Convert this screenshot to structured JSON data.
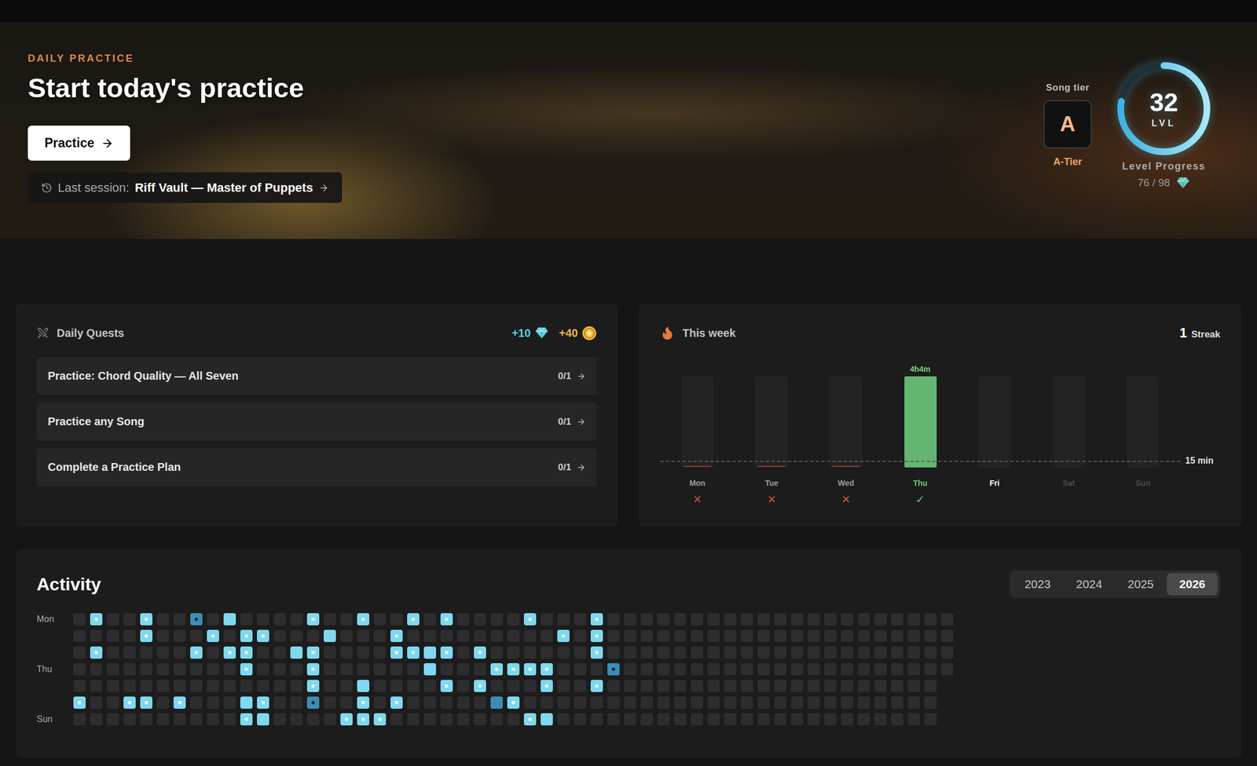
{
  "hero": {
    "eyebrow": "DAILY PRACTICE",
    "title": "Start today's practice",
    "button": "Practice",
    "last_session": {
      "label": "Last session:",
      "value": "Riff Vault — Master of Puppets"
    }
  },
  "song_tier": {
    "label": "Song tier",
    "grade": "A",
    "name": "A-Tier"
  },
  "level": {
    "value": "32",
    "unit": "LVL",
    "caption": "Level Progress",
    "reading": "76 / 98",
    "level": 0.776
  },
  "quests": {
    "title": "Daily Quests",
    "rewards": [
      {
        "amount": "+10",
        "kind": "gem",
        "color": "#5fd0e4"
      },
      {
        "amount": "+40",
        "kind": "coin",
        "color": "#f0b93a"
      }
    ],
    "items": [
      {
        "label": "Practice: Chord Quality — All Seven",
        "progress": "0/1"
      },
      {
        "label": "Practice any Song",
        "progress": "0/1"
      },
      {
        "label": "Complete a Practice Plan",
        "progress": "0/1"
      }
    ]
  },
  "week": {
    "title": "This week",
    "streak": {
      "count": "1",
      "label": "Streak"
    },
    "goal": {
      "minutes": 15,
      "label": "15 min"
    },
    "days": [
      {
        "label": "Mon",
        "minutes": 0,
        "mark": "✕",
        "status": "missed"
      },
      {
        "label": "Tue",
        "minutes": 0,
        "mark": "✕",
        "status": "missed"
      },
      {
        "label": "Wed",
        "minutes": 0,
        "mark": "✕",
        "status": "missed"
      },
      {
        "label": "Thu",
        "minutes": 244,
        "reading": "4h4m",
        "mark": "✓",
        "status": "done"
      },
      {
        "label": "Fri",
        "minutes": 0,
        "status": "today"
      },
      {
        "label": "Sat",
        "minutes": 0,
        "status": "upcoming"
      },
      {
        "label": "Sun",
        "minutes": 0,
        "status": "upcoming"
      }
    ]
  },
  "activity": {
    "title": "Activity",
    "years": [
      {
        "label": "2023",
        "selected": false
      },
      {
        "label": "2024",
        "selected": false
      },
      {
        "label": "2025",
        "selected": false
      },
      {
        "label": "2026",
        "selected": true
      }
    ],
    "rows": [
      {
        "label": "Mon",
        "levels": [
          0,
          1,
          0,
          0,
          1,
          0,
          0,
          0.5,
          0,
          1,
          0,
          0,
          0,
          0,
          1,
          0,
          0,
          1,
          0,
          0,
          1,
          0,
          1,
          0,
          0,
          0,
          0,
          1,
          0,
          0,
          0,
          1,
          0,
          0,
          0,
          0,
          0,
          0,
          0,
          0,
          0,
          0,
          0,
          0,
          0,
          0,
          0,
          0,
          0,
          0,
          0,
          0,
          0
        ],
        "dots": [
          1,
          4,
          7,
          14,
          17,
          20,
          22,
          27,
          31
        ]
      },
      {
        "levels": [
          0,
          0,
          0,
          0,
          1,
          0,
          0,
          0,
          1,
          0,
          1,
          1,
          0,
          0,
          0,
          1,
          0,
          0,
          0,
          1,
          0,
          0,
          0,
          0,
          0,
          0,
          0,
          0,
          0,
          1,
          0,
          1,
          0,
          0,
          0,
          0,
          0,
          0,
          0,
          0,
          0,
          0,
          0,
          0,
          0,
          0,
          0,
          0,
          0,
          0,
          0,
          0,
          0
        ],
        "dots": [
          4,
          8,
          10,
          11,
          19,
          29,
          31
        ]
      },
      {
        "levels": [
          0,
          1,
          0,
          0,
          0,
          0,
          0,
          1,
          0,
          1,
          1,
          0,
          0,
          1,
          1,
          0,
          0,
          0,
          0,
          1,
          1,
          1,
          1,
          0,
          1,
          0,
          0,
          0,
          0,
          0,
          0,
          1,
          0,
          0,
          0,
          0,
          0,
          0,
          0,
          0,
          0,
          0,
          0,
          0,
          0,
          0,
          0,
          0,
          0,
          0,
          0,
          0,
          0
        ],
        "dots": [
          1,
          7,
          9,
          10,
          14,
          19,
          20,
          22,
          24,
          31
        ]
      },
      {
        "label": "Thu",
        "levels": [
          0,
          0,
          0,
          0,
          0,
          0,
          0,
          0,
          0,
          0,
          1,
          0,
          0,
          0,
          1,
          0,
          0,
          0,
          0,
          0,
          0,
          1,
          0,
          0,
          0,
          1,
          1,
          1,
          1,
          0,
          0,
          0,
          0.5,
          0,
          0,
          0,
          0,
          0,
          0,
          0,
          0,
          0,
          0,
          0,
          0,
          0,
          0,
          0,
          0,
          0,
          0,
          0,
          0
        ],
        "dots": [
          10,
          14,
          25,
          26,
          27,
          28,
          32
        ]
      },
      {
        "levels": [
          0,
          0,
          0,
          0,
          0,
          0,
          0,
          0,
          0,
          0,
          0,
          0,
          0,
          0,
          1,
          0,
          0,
          1,
          0,
          0,
          0,
          0,
          1,
          0,
          1,
          0,
          0,
          0,
          1,
          0,
          0,
          1,
          0,
          0,
          0,
          0,
          0,
          0,
          0,
          0,
          0,
          0,
          0,
          0,
          0,
          0,
          0,
          0,
          0,
          0,
          0,
          0
        ],
        "dots": [
          14,
          22,
          24,
          28,
          31
        ]
      },
      {
        "levels": [
          1,
          0,
          0,
          1,
          1,
          0,
          1,
          0,
          0,
          0,
          1,
          1,
          0,
          0,
          0.5,
          0,
          0,
          1,
          0,
          1,
          0,
          0,
          0,
          0,
          0,
          0.5,
          1,
          0,
          0,
          0,
          0,
          0,
          0,
          0,
          0,
          0,
          0,
          0,
          0,
          0,
          0,
          0,
          0,
          0,
          0,
          0,
          0,
          0,
          0,
          0,
          0,
          0
        ],
        "dots": [
          0,
          3,
          4,
          6,
          11,
          14,
          17,
          19,
          26
        ]
      },
      {
        "label": "Sun",
        "levels": [
          0,
          0,
          0,
          0,
          0,
          0,
          0,
          0,
          0,
          0,
          1,
          1,
          0,
          0,
          0,
          0,
          1,
          1,
          1,
          0,
          0,
          0,
          0,
          0,
          0,
          0,
          0,
          1,
          1,
          0,
          0,
          0,
          0,
          0,
          0,
          0,
          0,
          0,
          0,
          0,
          0,
          0,
          0,
          0,
          0,
          0,
          0,
          0,
          0,
          0,
          0,
          0
        ],
        "dots": [
          10,
          16,
          17,
          18,
          27
        ]
      }
    ]
  }
}
